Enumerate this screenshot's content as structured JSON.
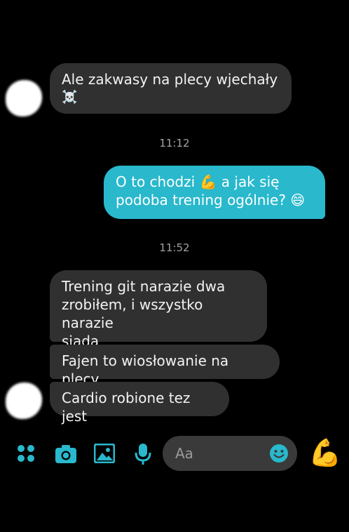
{
  "messages": [
    {
      "from": "them",
      "text_line1": "Ale zakwasy na plecy wjechały",
      "text_line2": "☠️"
    },
    {
      "from": "time",
      "text": "11:12"
    },
    {
      "from": "me",
      "line1": "O to chodzi 💪 a jak się",
      "line2": "podoba trening ogólnie? 😄"
    },
    {
      "from": "time",
      "text": "11:52"
    },
    {
      "from": "them",
      "line1": "Trening git narazie dwa",
      "line2": "zrobiłem, i wszystko narazie",
      "line3": "siada"
    },
    {
      "from": "them",
      "text": "Fajen to wiosłowanie na plecy"
    },
    {
      "from": "them",
      "text": "Cardio robione tez jest"
    }
  ],
  "composer": {
    "placeholder": "Aa",
    "quick_reaction": "💪",
    "icons": [
      "apps-icon",
      "camera-icon",
      "image-icon",
      "microphone-icon",
      "emoji-icon"
    ]
  },
  "colors": {
    "accent": "#29b8cc",
    "incoming_bubble": "#303030",
    "background": "#000000"
  }
}
